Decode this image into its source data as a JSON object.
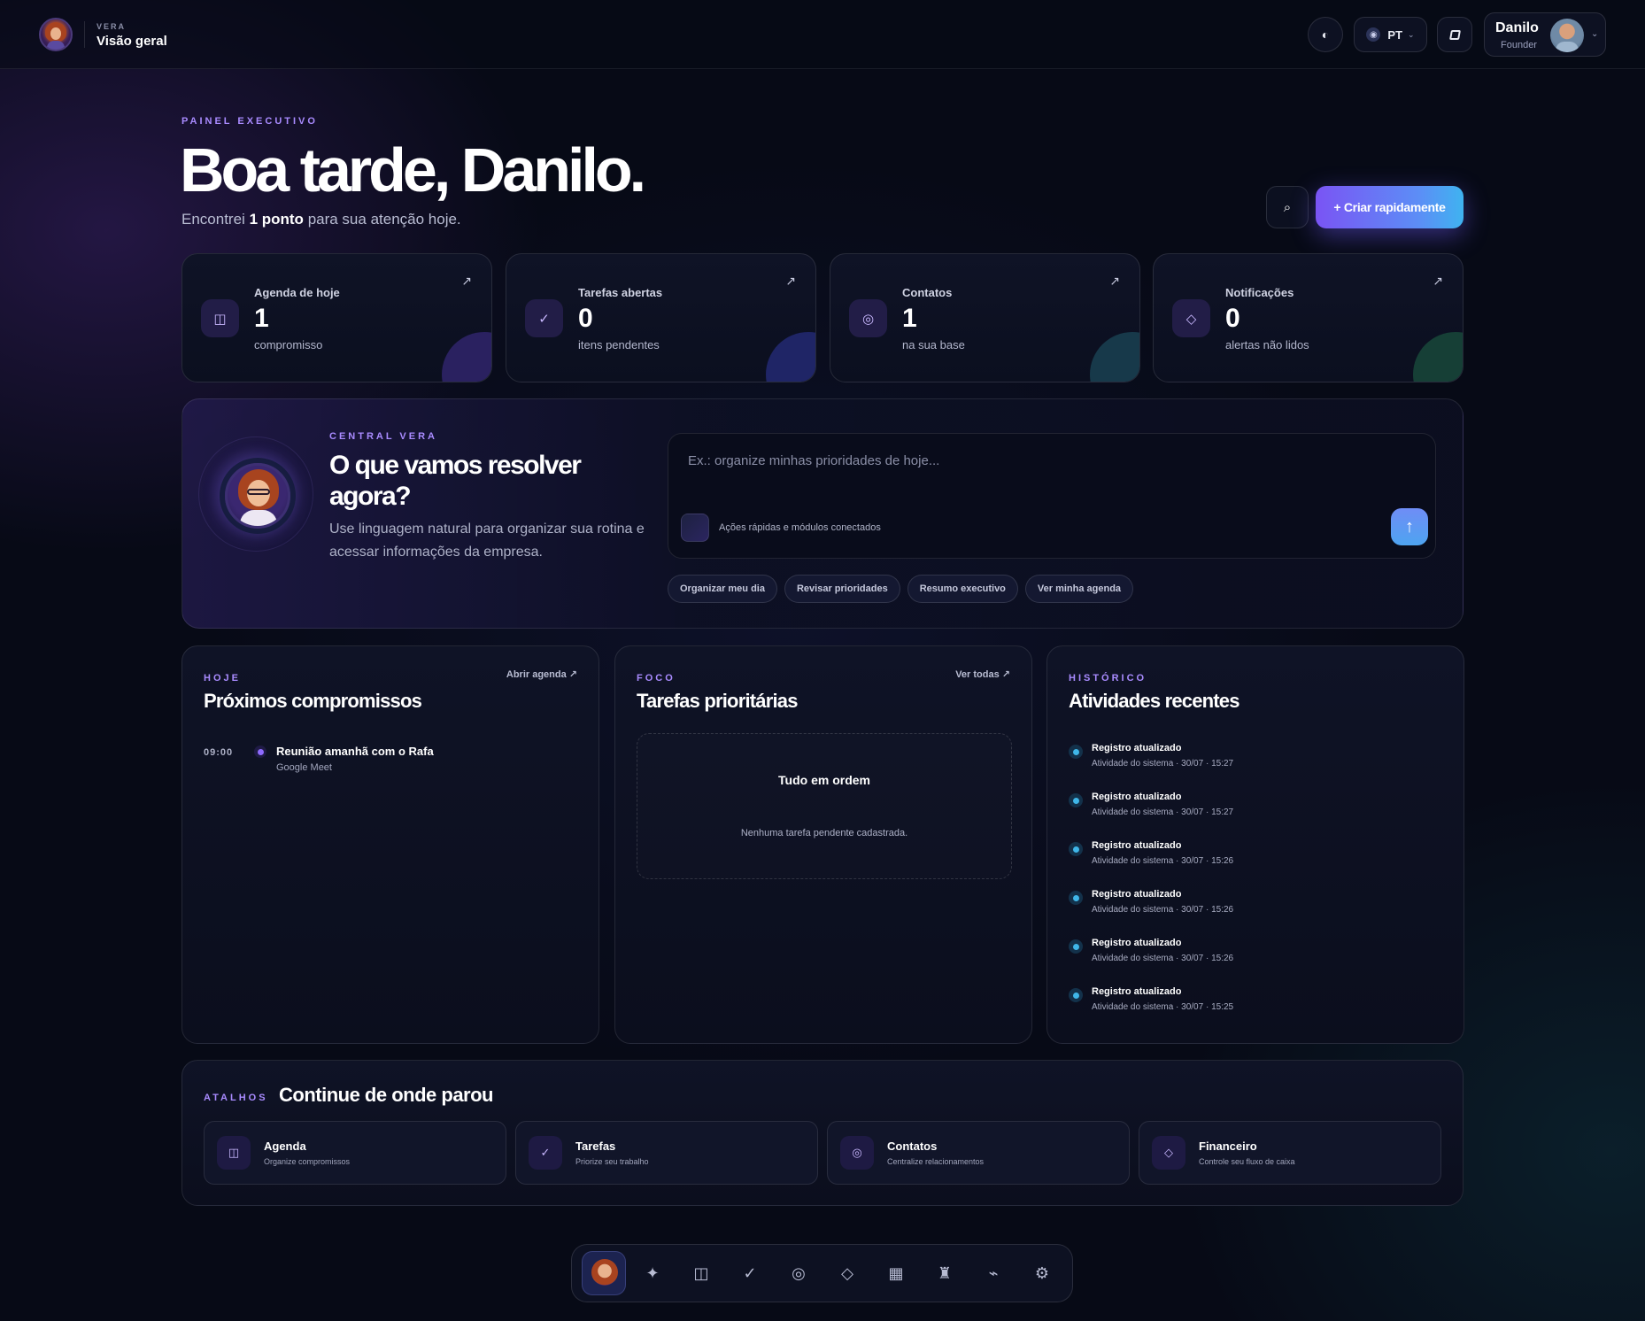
{
  "topbar": {
    "brand_kicker": "VERA",
    "brand_title": "Visão geral",
    "theme_icon": "half-moon-icon",
    "language": "PT",
    "notes_icon": "note-icon",
    "user": {
      "name": "Danilo",
      "role": "Founder"
    }
  },
  "hero": {
    "kicker": "PAINEL EXECUTIVO",
    "title": "Boa tarde, Danilo.",
    "subtitle_prefix": "Encontrei",
    "subtitle_bold": "1 ponto",
    "subtitle_suffix": "para sua atenção hoje.",
    "search_icon": "⌕",
    "create_button": "+ Criar rapidamente"
  },
  "stats": [
    {
      "label": "Agenda de hoje",
      "value": "1",
      "desc": "compromisso",
      "icon": "◫",
      "arrow": "↗",
      "accent": "#3a2a78"
    },
    {
      "label": "Tarefas abertas",
      "value": "0",
      "desc": "itens pendentes",
      "icon": "✓",
      "arrow": "↗",
      "accent": "#2c2e7a"
    },
    {
      "label": "Contatos",
      "value": "1",
      "desc": "na sua base",
      "icon": "◎",
      "arrow": "↗",
      "accent": "#1d4452"
    },
    {
      "label": "Notificações",
      "value": "0",
      "desc": "alertas não lidos",
      "icon": "◇",
      "arrow": "↗",
      "accent": "#1b4a3e"
    }
  ],
  "vera": {
    "kicker": "CENTRAL VERA",
    "title": "O que vamos resolver agora?",
    "description": "Use linguagem natural para organizar sua rotina e acessar informações da empresa.",
    "prompt_placeholder": "Ex.: organize minhas prioridades de hoje...",
    "quick_actions_label": "Ações rápidas e módulos conectados",
    "send_icon": "↑",
    "suggestions": [
      "Organizar meu dia",
      "Revisar prioridades",
      "Resumo executivo",
      "Ver minha agenda"
    ]
  },
  "today": {
    "kicker": "HOJE",
    "title": "Próximos compromissos",
    "link": "Abrir agenda ↗",
    "appointment": {
      "time": "09:00",
      "title": "Reunião amanhã com o Rafa",
      "subtitle": "Google Meet"
    }
  },
  "focus": {
    "kicker": "FOCO",
    "title": "Tarefas prioritárias",
    "link": "Ver todas ↗",
    "empty_title": "Tudo em ordem",
    "empty_subtitle": "Nenhuma tarefa pendente cadastrada."
  },
  "history": {
    "kicker": "HISTÓRICO",
    "title": "Atividades recentes",
    "items": [
      {
        "title": "Registro atualizado",
        "subtitle": "Atividade do sistema · 30/07 · 15:27"
      },
      {
        "title": "Registro atualizado",
        "subtitle": "Atividade do sistema · 30/07 · 15:27"
      },
      {
        "title": "Registro atualizado",
        "subtitle": "Atividade do sistema · 30/07 · 15:26"
      },
      {
        "title": "Registro atualizado",
        "subtitle": "Atividade do sistema · 30/07 · 15:26"
      },
      {
        "title": "Registro atualizado",
        "subtitle": "Atividade do sistema · 30/07 · 15:26"
      },
      {
        "title": "Registro atualizado",
        "subtitle": "Atividade do sistema · 30/07 · 15:25"
      }
    ]
  },
  "shortcuts": {
    "kicker": "ATALHOS",
    "title": "Continue de onde parou",
    "items": [
      {
        "name": "Agenda",
        "desc": "Organize compromissos",
        "icon": "◫"
      },
      {
        "name": "Tarefas",
        "desc": "Priorize seu trabalho",
        "icon": "✓"
      },
      {
        "name": "Contatos",
        "desc": "Centralize relacionamentos",
        "icon": "◎"
      },
      {
        "name": "Financeiro",
        "desc": "Controle seu fluxo de caixa",
        "icon": "◇"
      }
    ]
  },
  "dock": {
    "items": [
      {
        "name": "sparkle-icon",
        "glyph": "✦"
      },
      {
        "name": "calendar-icon",
        "glyph": "◫"
      },
      {
        "name": "check-icon",
        "glyph": "✓"
      },
      {
        "name": "contacts-icon",
        "glyph": "◎"
      },
      {
        "name": "finance-icon",
        "glyph": "◇"
      },
      {
        "name": "grid-icon",
        "glyph": "▦"
      },
      {
        "name": "tower-icon",
        "glyph": "♜"
      },
      {
        "name": "activity-icon",
        "glyph": "⌁"
      },
      {
        "name": "settings-icon",
        "glyph": "⚙"
      }
    ]
  }
}
